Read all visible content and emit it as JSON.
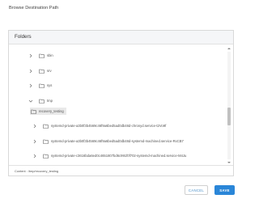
{
  "dialog": {
    "title": "Browse Destination Path"
  },
  "panel": {
    "header": "Folders"
  },
  "tree": {
    "items": [
      {
        "label": "sbin",
        "expanded": false,
        "selected": false
      },
      {
        "label": "srv",
        "expanded": false,
        "selected": false
      },
      {
        "label": "sys",
        "expanded": false,
        "selected": false
      },
      {
        "label": "tmp",
        "expanded": true,
        "selected": false
      },
      {
        "label": "recovery_testing",
        "expanded": false,
        "selected": true
      },
      {
        "label": "systemd-private-a3b0f3b4569c46f9a6bed5ad0db48d-chronyd.service-t2Vo9f",
        "expanded": false,
        "selected": false
      },
      {
        "label": "systemd-private-a3b0f3b4569c46f9a6bed5ad0db48d-systemd-machined.service-RxCB7",
        "expanded": false,
        "selected": false
      },
      {
        "label": "systemd-private-c3616bda6ed0c4651807bd6c991f0f702-systemd-machined.service-M4Ju",
        "expanded": false,
        "selected": false
      }
    ]
  },
  "scrollbar": {
    "position": 0.62
  },
  "footer": {
    "content": "Content : /tmp/recovery_testing"
  },
  "buttons": {
    "cancel": "CANCEL",
    "save": "SAVE"
  },
  "colors": {
    "accent": "#2a86d8",
    "cancel_text": "#4a90c9",
    "header_bg": "#f5f6f8",
    "selected_bg": "#e9e9e9"
  },
  "icons": {
    "collapsed": "chevron-right-icon",
    "expanded": "chevron-down-icon",
    "folder": "folder-icon"
  }
}
